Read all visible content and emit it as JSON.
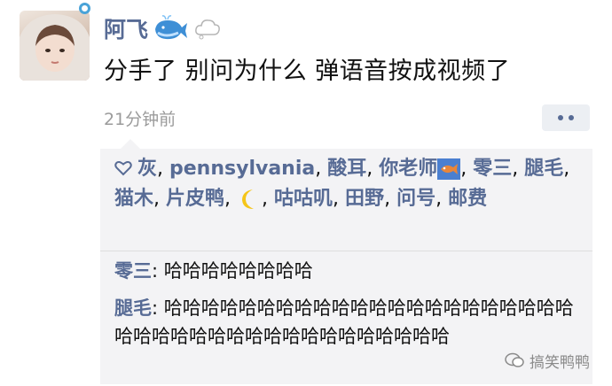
{
  "post": {
    "username": "阿飞",
    "text": "分手了 别问为什么 弹语音按成视频了",
    "timestamp": "21分钟前"
  },
  "likes": {
    "names": [
      "灰",
      "pennsylvania",
      "酸耳",
      "你老师",
      "零三",
      "腿毛",
      "猫木",
      "片皮鸭",
      "咕咕叽",
      "田野",
      "问号",
      "邮费"
    ],
    "separator": ", "
  },
  "comments": [
    {
      "author": "零三",
      "text": "哈哈哈哈哈哈哈哈"
    },
    {
      "author": "腿毛",
      "text": "哈哈哈哈哈哈哈哈哈哈哈哈哈哈哈哈哈哈哈哈哈哈哈哈哈哈哈哈哈哈哈哈哈哈哈哈哈哈哈哈"
    }
  ],
  "comment_colon": ": ",
  "watermark": {
    "text": "搞笑鸭鸭"
  },
  "icons": {
    "like": "heart-outline-icon",
    "more": "more-dots-icon",
    "name_emoji_1": "whale-emoji",
    "name_emoji_2": "cloud-emoji",
    "like_emoji_1": "fish-emoji",
    "like_emoji_2": "crescent-moon-emoji"
  },
  "colors": {
    "name_link": "#576b95",
    "panel_bg": "#f3f3f5",
    "timestamp": "#9b9b9b"
  }
}
